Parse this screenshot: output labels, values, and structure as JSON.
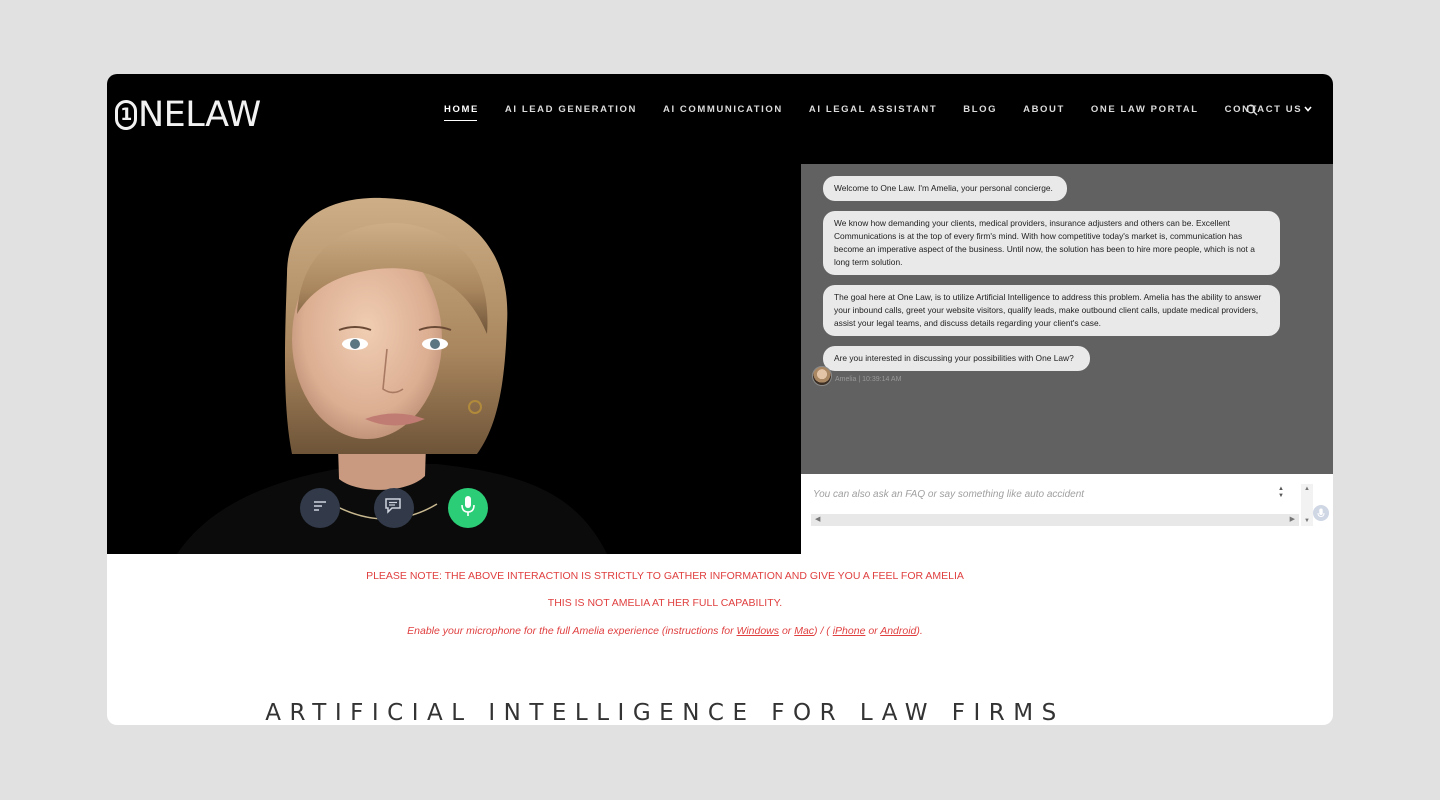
{
  "brand": {
    "mark": "1",
    "name": "NELAW"
  },
  "nav": {
    "items": [
      {
        "label": "HOME"
      },
      {
        "label": "AI LEAD GENERATION"
      },
      {
        "label": "AI COMMUNICATION"
      },
      {
        "label": "AI LEGAL ASSISTANT"
      },
      {
        "label": "BLOG"
      },
      {
        "label": "ABOUT"
      },
      {
        "label": "ONE LAW PORTAL"
      },
      {
        "label": "CONTACT US"
      }
    ],
    "active": "HOME",
    "search_icon": "search-icon"
  },
  "colors": {
    "header_bg": "#000000",
    "chat_bg": "#616161",
    "bubble_bg": "#e9e9e9",
    "mic_button": "#2ccd77",
    "control_button": "#323a4a",
    "note_text": "#e04040",
    "page_bg": "#e1e1e1"
  },
  "avatar": {
    "controls": [
      {
        "icon": "transcript-icon"
      },
      {
        "icon": "chat-icon"
      },
      {
        "icon": "microphone-icon"
      }
    ]
  },
  "chat": {
    "messages": [
      {
        "text": "Welcome to One Law. I'm Amelia, your personal concierge."
      },
      {
        "text": "We know how demanding your clients, medical providers, insurance adjusters and others can be. Excellent Communications is at the top of every firm's mind. With how competitive today's market is, communication has become an imperative aspect of the business. Until now, the solution has been to hire more people, which is not a long term solution."
      },
      {
        "text": "The goal here at One Law, is to utilize Artificial Intelligence to address this problem. Amelia has the ability to answer your inbound calls, greet your website visitors, qualify leads, make outbound client calls, update medical providers, assist your legal teams, and discuss details regarding your client's case."
      },
      {
        "text": "Are you interested in discussing your possibilities with One Law?"
      }
    ],
    "last_meta": "Amelia | 10:39:14 AM",
    "input_placeholder": "You can also ask an FAQ or say something like auto accident",
    "input_value": ""
  },
  "notes": {
    "line1": "PLEASE NOTE: THE ABOVE INTERACTION IS STRICTLY TO GATHER INFORMATION AND GIVE YOU A FEEL FOR AMELIA",
    "line2": "THIS IS NOT AMELIA AT HER FULL CAPABILITY.",
    "line3_prefix": "Enable your microphone for the full Amelia experience (instructions for ",
    "link_windows": "Windows",
    "sep_or_1": " or ",
    "link_mac": "Mac",
    "sep_mid": ") / ( ",
    "link_iphone": "iPhone",
    "sep_or_2": " or ",
    "link_android": "Android",
    "line3_suffix": ")."
  },
  "section": {
    "title": "ARTIFICIAL INTELLIGENCE FOR LAW FIRMS"
  }
}
